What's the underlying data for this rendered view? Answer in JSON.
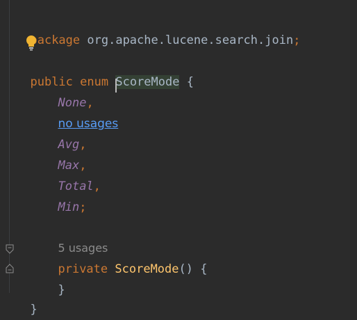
{
  "code": {
    "package_keyword": "package",
    "package_name": "org.apache.lucene.search.join",
    "semicolon": ";",
    "public_keyword": "public",
    "enum_keyword": "enum",
    "enum_name": "ScoreMode",
    "open_brace": "{",
    "constants": [
      {
        "name": "None",
        "sep": ","
      },
      {
        "name": "Avg",
        "sep": ","
      },
      {
        "name": "Max",
        "sep": ","
      },
      {
        "name": "Total",
        "sep": ","
      },
      {
        "name": "Min",
        "sep": ";"
      }
    ],
    "no_usages_hint": "no usages",
    "usages_hint": "5 usages",
    "private_keyword": "private",
    "constructor_name": "ScoreMode",
    "constructor_parens": "()",
    "close_brace": "}",
    "outer_close_brace": "}"
  },
  "icons": {
    "intention": "lightbulb-icon",
    "fold_start": "fold-start-icon",
    "fold_end": "fold-end-icon"
  },
  "colors": {
    "background": "#2b2b2b",
    "keyword": "#cc7832",
    "enum_constant": "#9876aa",
    "function": "#ffc66d",
    "identifier": "#a9b7c6",
    "hint": "#8c8c8c",
    "link": "#589df6",
    "bulb": "#f0b432"
  }
}
